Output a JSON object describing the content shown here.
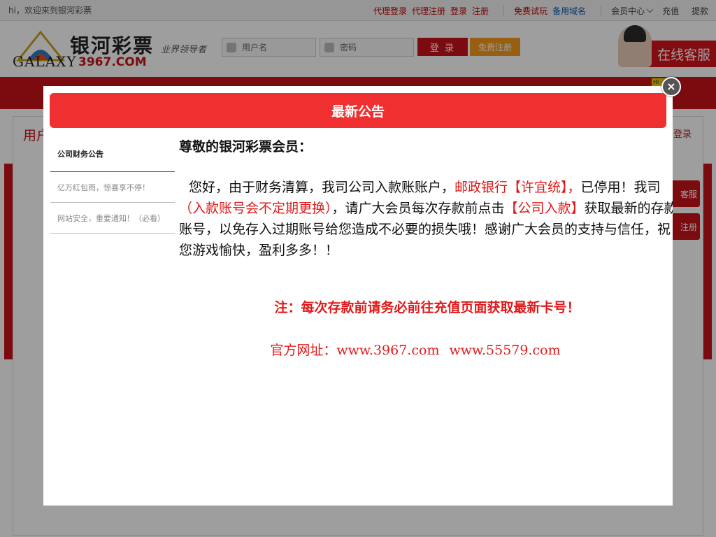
{
  "topbar": {
    "greeting": "hi，欢迎来到银河彩票",
    "links": [
      "代理登录",
      "代理注册",
      "登录",
      "注册"
    ],
    "trial": "免费试玩",
    "backup": "备用域名",
    "member_center": "会员中心",
    "recharge": "充值",
    "withdraw": "提款"
  },
  "header": {
    "logo_cn": "银河彩票",
    "logo_en": "GALAXY",
    "logo_num": "3967.COM",
    "slogan": "业界领导者",
    "username_placeholder": "用户名",
    "password_placeholder": "密码",
    "login_button": "登 录",
    "register_button": "免费注册",
    "customer_service": "在线客服"
  },
  "background": {
    "user_label": "用户",
    "login_label": "登录",
    "service_btn": "客服",
    "register_btn": "注册"
  },
  "modal": {
    "title": "最新公告",
    "notices": [
      "公司财务公告",
      "亿万红包雨，惊喜享不停！",
      "网站安全，重要通知！（必看）"
    ],
    "greeting": "尊敬的银河彩票会员：",
    "para_1": "您好，由于财务清算，我司公司入款账账户，",
    "para_bank": "邮政银行【许宜统】，",
    "para_2": "已停用！我司",
    "para_change": "（入款账号会不定期更换）",
    "para_3": "，请广大会员每次存款前点击",
    "para_company": "【公司入款】",
    "para_4": "获取最新的存款账号，以免存入过期账号给您造成不必要的损失哦！感谢广大会员的支持与信任，祝您游戏愉快，盈利多多！！",
    "note": "注：每次存款前请务必前往充值页面获取最新卡号！",
    "site_label": "官方网址：",
    "site_1": "www.3967.com",
    "site_2": "www.55579.com",
    "close": "×"
  },
  "colors": {
    "brand_red": "#c9131b",
    "header_red": "#f03030",
    "accent_orange": "#f39a1e",
    "link_blue": "#0a5bb5"
  }
}
